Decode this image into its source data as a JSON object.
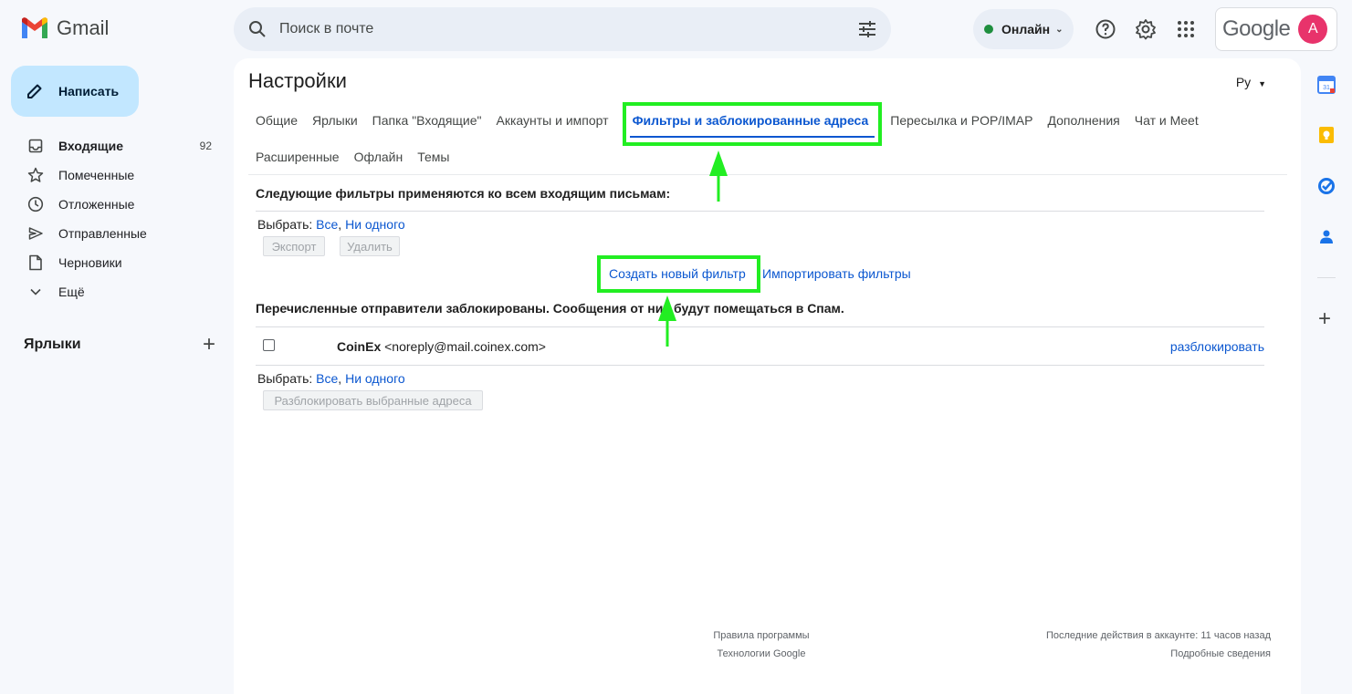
{
  "header": {
    "app_name": "Gmail",
    "search_placeholder": "Поиск в почте",
    "status_label": "Онлайн",
    "google_wordmark": "Google",
    "avatar_letter": "A"
  },
  "sidebar": {
    "compose_label": "Написать",
    "items": [
      {
        "label": "Входящие",
        "count": "92",
        "icon": "inbox-icon"
      },
      {
        "label": "Помеченные",
        "icon": "star-icon"
      },
      {
        "label": "Отложенные",
        "icon": "clock-icon"
      },
      {
        "label": "Отправленные",
        "icon": "send-icon"
      },
      {
        "label": "Черновики",
        "icon": "draft-icon"
      },
      {
        "label": "Ещё",
        "icon": "chevron-down-icon"
      }
    ],
    "labels_title": "Ярлыки"
  },
  "settings": {
    "title": "Настройки",
    "language": "Ру",
    "tabs_row1": [
      "Общие",
      "Ярлыки",
      "Папка \"Входящие\"",
      "Аккаунты и импорт",
      "Фильтры и заблокированные адреса",
      "Пересылка и POP/IMAP",
      "Дополнения",
      "Чат и Meet"
    ],
    "tabs_row2": [
      "Расширенные",
      "Офлайн",
      "Темы"
    ],
    "active_tab": "Фильтры и заблокированные адреса"
  },
  "filters": {
    "heading": "Следующие фильтры применяются ко всем входящим письмам:",
    "select_label": "Выбрать:",
    "select_all": "Все",
    "select_none": "Ни одного",
    "export_button": "Экспорт",
    "delete_button": "Удалить",
    "create_filter": "Создать новый фильтр",
    "import_filters": "Импортировать фильтры"
  },
  "blocked": {
    "heading": "Перечисленные отправители заблокированы. Сообщения от них будут помещаться в Спам.",
    "rows": [
      {
        "name": "CoinEx",
        "email": "<noreply@mail.coinex.com>",
        "action": "разблокировать"
      }
    ],
    "select_label": "Выбрать:",
    "select_all": "Все",
    "select_none": "Ни одного",
    "unblock_selected": "Разблокировать выбранные адреса"
  },
  "footer": {
    "program_policies": "Правила программы",
    "google_tech": "Технологии Google",
    "last_activity": "Последние действия в аккаунте: 11 часов назад",
    "details": "Подробные сведения"
  },
  "colors": {
    "accent": "#0b57d0",
    "compose_bg": "#c2e7ff",
    "highlight": "#22ee22",
    "online": "#1e8e3e"
  }
}
